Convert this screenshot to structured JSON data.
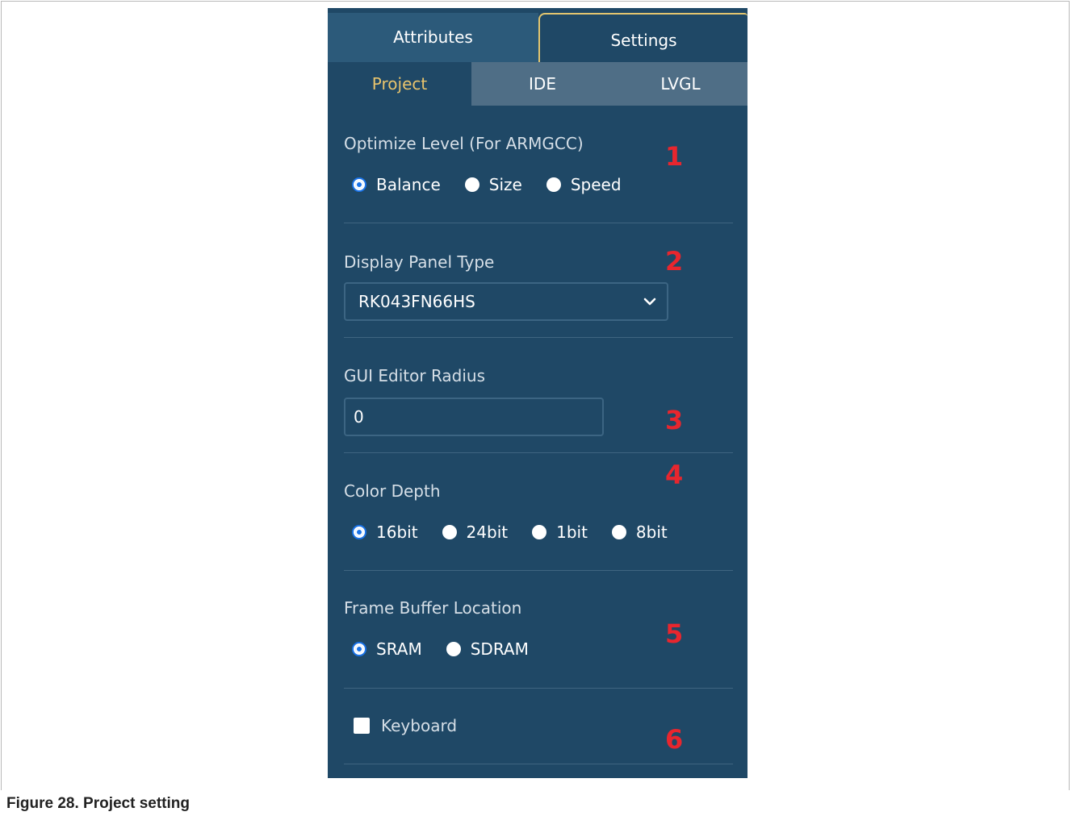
{
  "caption": "Figure 28.  Project setting",
  "tabs": {
    "top": [
      {
        "label": "Attributes"
      },
      {
        "label": "Settings",
        "active": true
      }
    ],
    "sub": [
      {
        "label": "Project",
        "active": true
      },
      {
        "label": "IDE"
      },
      {
        "label": "LVGL"
      }
    ]
  },
  "optimize": {
    "label": "Optimize Level (For ARMGCC)",
    "options": [
      "Balance",
      "Size",
      "Speed"
    ],
    "selected": "Balance",
    "marker": "1"
  },
  "display_panel": {
    "label": "Display Panel Type",
    "value": "RK043FN66HS",
    "marker": "2"
  },
  "gui_radius": {
    "label": "GUI Editor Radius",
    "value": "0",
    "marker": "3"
  },
  "color_depth": {
    "label": "Color Depth",
    "options": [
      "16bit",
      "24bit",
      "1bit",
      "8bit"
    ],
    "selected": "16bit",
    "marker": "4"
  },
  "frame_buffer": {
    "label": "Frame Buffer Location",
    "options": [
      "SRAM",
      "SDRAM"
    ],
    "selected": "SRAM",
    "marker": "5"
  },
  "keyboard": {
    "label": "Keyboard",
    "checked": false,
    "marker": "6"
  },
  "colors": {
    "panel_bg": "#1f4866",
    "tab_inactive": "#2c5a7a",
    "subtab_inactive": "#4f6e86",
    "active_subtab_text": "#e8c46d",
    "marker": "#e8262e",
    "radio_selected": "#1a73e8"
  }
}
